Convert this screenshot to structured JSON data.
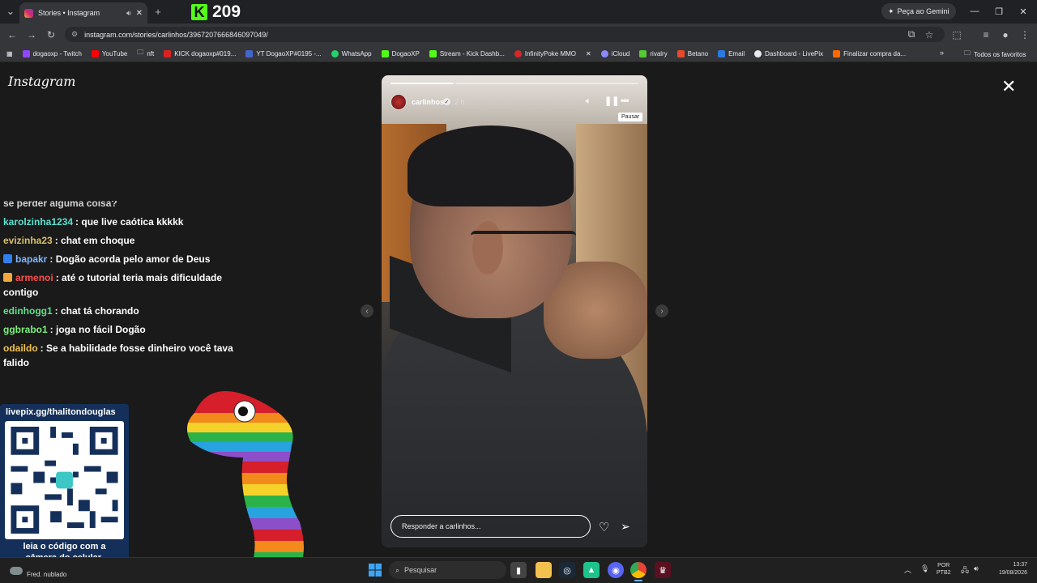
{
  "browser": {
    "tab": {
      "title": "Stories • Instagram",
      "audio_icon": "speaker-icon",
      "close": "✕"
    },
    "new_tab": "+",
    "kick_count": "209",
    "gemini_label": "Peça ao Gemini",
    "url": "instagram.com/stories/carlinhos/3967207666846097049/",
    "bookmarks": [
      {
        "label": "dogaoxp - Twitch",
        "color": "#9146ff"
      },
      {
        "label": "YouTube",
        "color": "#ff0000"
      },
      {
        "label": "nft",
        "color": "#777777"
      },
      {
        "label": "KICK dogaoxp#019...",
        "color": "#e02020"
      },
      {
        "label": "YT DogaoXP#0195 -...",
        "color": "#4466cc"
      },
      {
        "label": "WhatsApp",
        "color": "#25d366"
      },
      {
        "label": "DogaoXP",
        "color": "#53fc18"
      },
      {
        "label": "Stream - Kick Dashb...",
        "color": "#53fc18"
      },
      {
        "label": "InfinityPoke MMO",
        "color": "#d62828"
      },
      {
        "label": "",
        "color": "#000000"
      },
      {
        "label": "iCloud",
        "color": "#8a8aff"
      },
      {
        "label": "rivalry",
        "color": "#55cc33"
      },
      {
        "label": "Betano",
        "color": "#e8492b"
      },
      {
        "label": "Email",
        "color": "#2a7ae2"
      },
      {
        "label": "Dashboard - LivePix",
        "color": "#e8eaed"
      },
      {
        "label": "Finalizar compra da...",
        "color": "#ff6a00"
      }
    ],
    "all_favorites": "Todos os favoritos"
  },
  "instagram": {
    "logo": "Instagram",
    "story": {
      "username": "carlinhos",
      "age": "2 h",
      "tooltip": "Pausar",
      "reply_placeholder": "Responder a carlinhos..."
    }
  },
  "chat": {
    "partial_top": "se perder alguma coisa?",
    "messages": [
      {
        "user": "karolzinha1234",
        "color": "#5fe0d0",
        "badge": "",
        "text": ": que live caótica kkkkk"
      },
      {
        "user": "evizinha23",
        "color": "#d8c06a",
        "badge": "",
        "text": ": chat em choque"
      },
      {
        "user": "bapakr",
        "color": "#7fb7ff",
        "badge": "#2f80ed",
        "text": ": Dogão acorda pelo amor de Deus"
      },
      {
        "user": "armenoi",
        "color": "#ff4d4d",
        "badge": "#f2a93b",
        "text": ": até o tutorial teria mais dificuldade contigo"
      },
      {
        "user": "edinhogg1",
        "color": "#5fe08a",
        "badge": "",
        "text": ": chat tá chorando"
      },
      {
        "user": "ggbrabo1",
        "color": "#7ef07e",
        "badge": "",
        "text": ": joga no fácil Dogão"
      },
      {
        "user": "odaildo",
        "color": "#f2c14e",
        "badge": "",
        "text": ": Se a habilidade fosse dinheiro você tava falido"
      }
    ]
  },
  "livepix": {
    "url": "livepix.gg/thalitondouglas",
    "caption_line1": "leia o código com a",
    "caption_line2": "câmera do celular."
  },
  "taskbar": {
    "weather": "Fred. nublado",
    "search_placeholder": "Pesquisar",
    "lang_line1": "POR",
    "lang_line2": "PTB2",
    "time": "13:37",
    "date": "19/08/2026"
  }
}
